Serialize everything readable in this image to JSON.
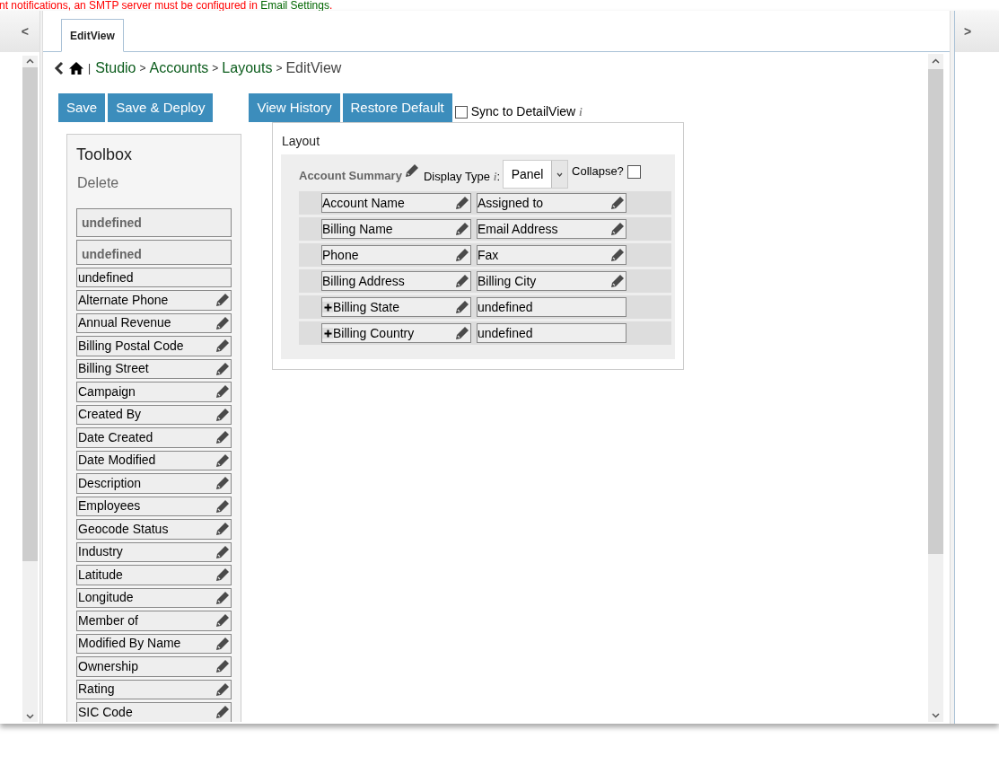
{
  "notification": {
    "text": "nt notifications, an SMTP server must be configured in ",
    "link": "Email Settings",
    "end": "."
  },
  "nav": {
    "left_arrow": "<",
    "right_arrow": ">"
  },
  "tabs": [
    {
      "label": "EditView",
      "selected": true
    }
  ],
  "breadcrumb": {
    "divider": "|",
    "links": [
      "Studio",
      "Accounts",
      "Layouts"
    ],
    "separator": ">",
    "current": "EditView"
  },
  "buttons_left": [
    "Save",
    "Save & Deploy"
  ],
  "buttons_right": [
    "View History",
    "Restore Default"
  ],
  "sync": {
    "label": "Sync to DetailView",
    "checked": false,
    "info": "i"
  },
  "toolbox": {
    "title": "Toolbox",
    "delete_label": "Delete",
    "items": [
      {
        "label": "undefined",
        "kind": "header"
      },
      {
        "label": "undefined",
        "kind": "header"
      },
      {
        "label": "undefined",
        "kind": "plain"
      },
      {
        "label": "Alternate Phone",
        "kind": "field"
      },
      {
        "label": "Annual Revenue",
        "kind": "field"
      },
      {
        "label": "Billing Postal Code",
        "kind": "field"
      },
      {
        "label": "Billing Street",
        "kind": "field"
      },
      {
        "label": "Campaign",
        "kind": "field"
      },
      {
        "label": "Created By",
        "kind": "field"
      },
      {
        "label": "Date Created",
        "kind": "field"
      },
      {
        "label": "Date Modified",
        "kind": "field"
      },
      {
        "label": "Description",
        "kind": "field"
      },
      {
        "label": "Employees",
        "kind": "field"
      },
      {
        "label": "Geocode Status",
        "kind": "field"
      },
      {
        "label": "Industry",
        "kind": "field"
      },
      {
        "label": "Latitude",
        "kind": "field"
      },
      {
        "label": "Longitude",
        "kind": "field"
      },
      {
        "label": "Member of",
        "kind": "field"
      },
      {
        "label": "Modified By Name",
        "kind": "field"
      },
      {
        "label": "Ownership",
        "kind": "field"
      },
      {
        "label": "Rating",
        "kind": "field"
      },
      {
        "label": "SIC Code",
        "kind": "field"
      }
    ]
  },
  "layout": {
    "title": "Layout",
    "panel": {
      "name": "Account Summary",
      "display_type_label": "Display Type",
      "display_type_info": "i",
      "display_type_colon": ":",
      "display_type": "Panel",
      "collapse_label": "Collapse?",
      "collapsed": false,
      "rows": [
        [
          {
            "label": "Account Name",
            "kind": "field"
          },
          {
            "label": "Assigned to",
            "kind": "field"
          }
        ],
        [
          {
            "label": "Billing Name",
            "kind": "field"
          },
          {
            "label": "Email Address",
            "kind": "field"
          }
        ],
        [
          {
            "label": "Phone",
            "kind": "field"
          },
          {
            "label": "Fax",
            "kind": "field"
          }
        ],
        [
          {
            "label": "Billing Address",
            "kind": "field"
          },
          {
            "label": "Billing City",
            "kind": "field"
          }
        ],
        [
          {
            "label": "Billing State",
            "kind": "expandable"
          },
          {
            "label": "undefined",
            "kind": "plain"
          }
        ],
        [
          {
            "label": "Billing Country",
            "kind": "expandable"
          },
          {
            "label": "undefined",
            "kind": "plain"
          }
        ]
      ]
    }
  }
}
